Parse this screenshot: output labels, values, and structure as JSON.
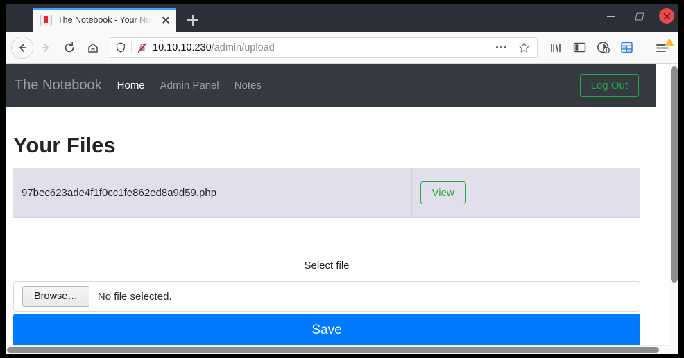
{
  "browser": {
    "tab": {
      "title": "The Notebook - Your Not",
      "favicon": "notebook-icon",
      "close_icon": "close-icon"
    },
    "new_tab_label": "+",
    "window_controls": {
      "minimize": "minimize-icon",
      "maximize": "maximize-icon",
      "close": "close-icon"
    },
    "toolbar": {
      "back": "back-arrow-icon",
      "forward": "forward-arrow-icon",
      "reload": "reload-icon",
      "home": "home-icon"
    },
    "urlbar": {
      "shield_icon": "shield-icon",
      "security_icon": "insecure-lock-icon",
      "host": "10.10.10.230",
      "path": "/admin/upload",
      "page_actions_icon": "ellipsis-icon",
      "bookmark_icon": "star-icon"
    },
    "extra_icons": [
      {
        "name": "library-icon"
      },
      {
        "name": "sidebar-icon"
      },
      {
        "name": "account-sync-icon"
      },
      {
        "name": "containers-icon"
      },
      {
        "name": "hamburger-menu-icon"
      }
    ]
  },
  "site": {
    "brand": "The Notebook",
    "nav_links": [
      {
        "label": "Home",
        "active": true
      },
      {
        "label": "Admin Panel",
        "active": false
      },
      {
        "label": "Notes",
        "active": false
      }
    ],
    "logout_label": "Log Out"
  },
  "main": {
    "heading": "Your Files",
    "files": [
      {
        "name": "97bec623ade4f1f0cc1fe862ed8a9d59.php",
        "action_label": "View"
      }
    ],
    "upload": {
      "select_label": "Select file",
      "browse_label": "Browse…",
      "no_file_text": "No file selected.",
      "save_label": "Save"
    }
  },
  "colors": {
    "navbar_bg": "#343a40",
    "success": "#28a745",
    "primary": "#007bff",
    "table_row": "#e1dfeb"
  }
}
